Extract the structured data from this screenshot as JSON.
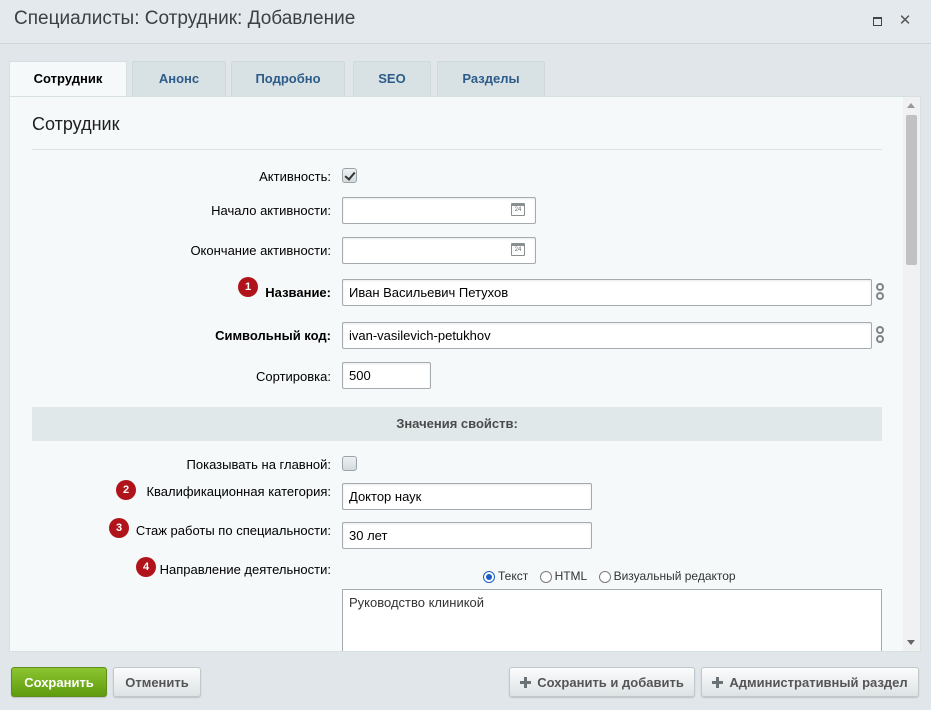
{
  "window": {
    "title": "Специалисты: Сотрудник: Добавление"
  },
  "tabs": [
    {
      "label": "Сотрудник",
      "active": true
    },
    {
      "label": "Анонс",
      "active": false
    },
    {
      "label": "Подробно",
      "active": false
    },
    {
      "label": "SEO",
      "active": false
    },
    {
      "label": "Разделы",
      "active": false
    }
  ],
  "section": {
    "title": "Сотрудник"
  },
  "form": {
    "active": {
      "label": "Активность:",
      "checked": true
    },
    "active_from": {
      "label": "Начало активности:",
      "value": ""
    },
    "active_to": {
      "label": "Окончание активности:",
      "value": ""
    },
    "name": {
      "badge": "1",
      "label": "Название:",
      "value": "Иван Васильевич Петухов"
    },
    "code": {
      "label": "Символьный код:",
      "value": "ivan-vasilevich-petukhov"
    },
    "sort": {
      "label": "Сортировка:",
      "value": "500"
    }
  },
  "properties": {
    "header": "Значения свойств:",
    "show_on_main": {
      "label": "Показывать на главной:",
      "checked": false
    },
    "category": {
      "badge": "2",
      "label": "Квалификационная категория:",
      "value": "Доктор наук"
    },
    "experience": {
      "badge": "3",
      "label": "Стаж работы по специальности:",
      "value": "30 лет"
    },
    "direction": {
      "badge": "4",
      "label": "Направление деятельности:",
      "modes": [
        {
          "label": "Текст",
          "checked": true
        },
        {
          "label": "HTML",
          "checked": false
        },
        {
          "label": "Визуальный редактор",
          "checked": false
        }
      ],
      "value": "Руководство клиникой"
    }
  },
  "calendar_icon_text": "24",
  "buttons": {
    "save": "Сохранить",
    "cancel": "Отменить",
    "save_and_add": "Сохранить и добавить",
    "admin_section": "Административный раздел"
  },
  "colors": {
    "primary_button": "#6aa817",
    "badge": "#b0141a",
    "tab_text": "#2d5c88"
  }
}
